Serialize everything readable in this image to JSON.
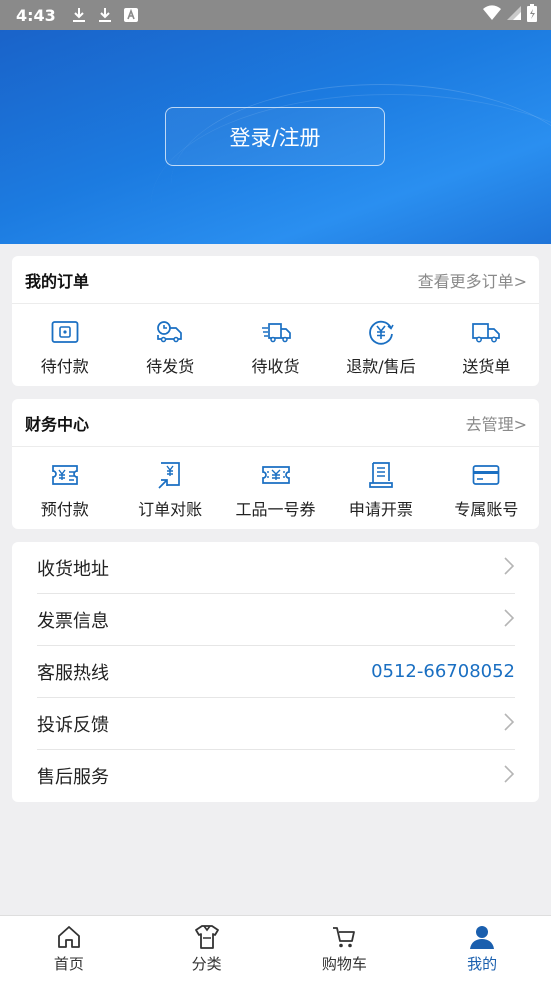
{
  "status_bar": {
    "time": "4:43"
  },
  "hero": {
    "login_label": "登录/注册"
  },
  "orders": {
    "title": "我的订单",
    "more": "查看更多订单>",
    "items": [
      {
        "label": "待付款",
        "icon": "wallet-icon"
      },
      {
        "label": "待发货",
        "icon": "truck-clock-icon"
      },
      {
        "label": "待收货",
        "icon": "delivery-truck-icon"
      },
      {
        "label": "退款/售后",
        "icon": "refund-icon"
      },
      {
        "label": "送货单",
        "icon": "truck-icon"
      }
    ]
  },
  "finance": {
    "title": "财务中心",
    "more": "去管理>",
    "items": [
      {
        "label": "预付款",
        "icon": "prepay-icon"
      },
      {
        "label": "订单对账",
        "icon": "reconcile-icon"
      },
      {
        "label": "工品一号券",
        "icon": "coupon-icon"
      },
      {
        "label": "申请开票",
        "icon": "invoice-icon"
      },
      {
        "label": "专属账号",
        "icon": "card-icon"
      }
    ]
  },
  "menu": {
    "items": [
      {
        "label": "收货地址"
      },
      {
        "label": "发票信息"
      },
      {
        "label": "客服热线",
        "value": "0512-66708052"
      },
      {
        "label": "投诉反馈"
      },
      {
        "label": "售后服务"
      }
    ]
  },
  "tabs": [
    {
      "label": "首页",
      "icon": "home-icon"
    },
    {
      "label": "分类",
      "icon": "shirt-icon"
    },
    {
      "label": "购物车",
      "icon": "cart-icon"
    },
    {
      "label": "我的",
      "icon": "user-icon"
    }
  ],
  "colors": {
    "primary": "#1a6fc2",
    "hero": "#1c7be0",
    "status_bar": "#8a8a8a"
  }
}
